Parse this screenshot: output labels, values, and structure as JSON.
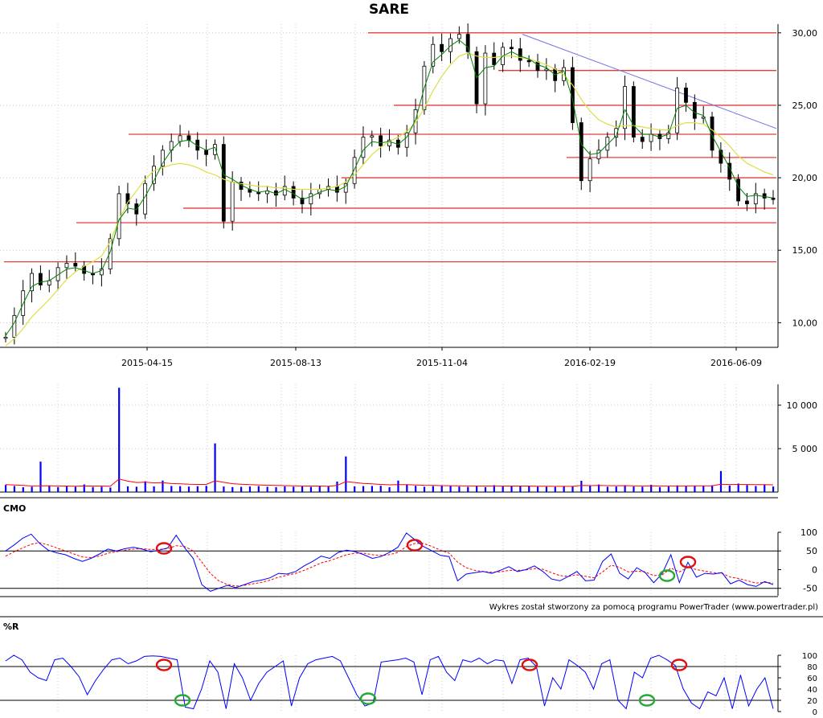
{
  "chart_data": [
    {
      "type": "candlestick",
      "title": "SARE",
      "y_ticks": [
        "30,00",
        "25,00",
        "20,00",
        "15,00",
        "10,00"
      ],
      "ylim": [
        8.3,
        30.6
      ],
      "x_ticks": [
        "2015-04-15",
        "2015-08-13",
        "2015-11-04",
        "2016-02-19",
        "2016-06-09"
      ],
      "price_close": [
        9.0,
        10.5,
        12.2,
        13.4,
        12.6,
        12.9,
        13.8,
        14.1,
        13.9,
        13.4,
        13.3,
        13.7,
        15.8,
        18.9,
        18.2,
        17.5,
        19.6,
        20.8,
        21.9,
        22.5,
        22.9,
        22.6,
        21.9,
        21.6,
        22.3,
        17.0,
        19.7,
        19.2,
        19.0,
        18.9,
        19.1,
        18.8,
        19.4,
        18.6,
        18.2,
        18.9,
        19.2,
        19.4,
        19.0,
        19.6,
        21.4,
        22.8,
        22.9,
        22.2,
        22.6,
        22.1,
        23.1,
        24.7,
        27.7,
        29.2,
        28.7,
        29.6,
        29.9,
        28.7,
        25.1,
        28.6,
        27.8,
        29.0,
        28.9,
        28.1,
        28.0,
        27.4,
        27.5,
        26.7,
        27.6,
        23.8,
        19.8,
        21.3,
        21.9,
        22.8,
        23.4,
        26.3,
        22.8,
        22.5,
        23.0,
        22.7,
        23.1,
        26.2,
        25.2,
        24.1,
        24.2,
        21.9,
        21.0,
        19.9,
        18.4,
        18.2,
        18.9,
        18.6,
        18.5
      ],
      "ma_short": [
        9.1,
        10.0,
        11.3,
        12.5,
        12.8,
        12.9,
        13.3,
        13.7,
        13.8,
        13.6,
        13.4,
        13.6,
        14.9,
        17.1,
        17.9,
        17.8,
        18.7,
        19.8,
        21.0,
        21.9,
        22.5,
        22.6,
        22.2,
        21.9,
        22.1,
        20.2,
        19.9,
        19.5,
        19.2,
        19.0,
        19.1,
        18.9,
        19.2,
        18.9,
        18.5,
        18.7,
        19.0,
        19.2,
        19.1,
        19.4,
        20.6,
        21.9,
        22.5,
        22.4,
        22.5,
        22.3,
        22.8,
        24.0,
        26.2,
        28.0,
        28.5,
        29.1,
        29.5,
        29.0,
        26.9,
        27.6,
        27.7,
        28.4,
        28.7,
        28.4,
        28.2,
        27.8,
        27.6,
        27.1,
        27.4,
        25.4,
        22.3,
        21.6,
        21.7,
        22.3,
        22.9,
        24.7,
        23.6,
        23.0,
        23.0,
        22.8,
        23.0,
        24.8,
        25.0,
        24.5,
        24.3,
        22.9,
        21.8,
        20.7,
        19.4,
        18.7,
        18.8,
        18.7,
        18.6
      ],
      "ma_long": [
        8.4,
        8.9,
        9.6,
        10.4,
        11.0,
        11.6,
        12.3,
        13.0,
        13.5,
        13.9,
        14.2,
        14.6,
        15.6,
        17.1,
        18.3,
        19.1,
        19.9,
        20.5,
        20.7,
        20.9,
        21.0,
        20.9,
        20.7,
        20.4,
        20.2,
        19.9,
        19.7,
        19.6,
        19.5,
        19.4,
        19.4,
        19.3,
        19.3,
        19.2,
        19.2,
        19.2,
        19.2,
        19.3,
        19.4,
        19.7,
        20.2,
        20.9,
        21.6,
        22.1,
        22.5,
        22.8,
        23.2,
        23.8,
        24.8,
        26.0,
        27.0,
        27.8,
        28.4,
        28.6,
        28.4,
        28.3,
        28.3,
        28.4,
        28.4,
        28.3,
        28.2,
        28.0,
        27.8,
        27.5,
        27.1,
        26.4,
        25.4,
        24.6,
        24.0,
        23.7,
        23.5,
        23.6,
        23.6,
        23.5,
        23.4,
        23.3,
        23.3,
        23.6,
        23.8,
        23.8,
        23.7,
        23.3,
        22.8,
        22.2,
        21.5,
        21.0,
        20.7,
        20.4,
        20.2
      ],
      "support_resistance_levels": [
        30.0,
        27.4,
        25.0,
        23.0,
        21.4,
        20.0,
        17.9,
        16.9,
        14.2
      ],
      "trendline": {
        "from": 29.9,
        "to": 23.4
      }
    },
    {
      "type": "bar",
      "series": [
        {
          "values": [
            820,
            700,
            560,
            620,
            3500,
            690,
            580,
            670,
            610,
            880,
            590,
            620,
            520,
            12000,
            660,
            610,
            1240,
            660,
            1320,
            700,
            680,
            630,
            680,
            720,
            5600,
            640,
            570,
            600,
            640,
            690,
            610,
            570,
            660,
            620,
            650,
            600,
            730,
            640,
            1210,
            4100,
            660,
            690,
            700,
            720,
            560,
            1320,
            830,
            720,
            610,
            680,
            700,
            690,
            630,
            600,
            710,
            570,
            790,
            640,
            700,
            680,
            690,
            620,
            610,
            590,
            700,
            640,
            1300,
            720,
            870,
            610,
            640,
            790,
            640,
            620,
            830,
            580,
            640,
            760,
            680,
            740,
            690,
            780,
            2420,
            760,
            980,
            810,
            700,
            880,
            640
          ]
        }
      ],
      "moving_average": [
        860,
        820,
        760,
        700,
        720,
        730,
        700,
        690,
        680,
        700,
        690,
        690,
        680,
        1500,
        1260,
        1100,
        1140,
        1060,
        1080,
        980,
        950,
        900,
        880,
        880,
        1300,
        1120,
        960,
        900,
        850,
        820,
        790,
        760,
        740,
        720,
        700,
        690,
        690,
        680,
        760,
        1200,
        1100,
        1000,
        940,
        880,
        830,
        860,
        850,
        820,
        780,
        760,
        740,
        730,
        720,
        700,
        700,
        690,
        700,
        690,
        690,
        690,
        690,
        680,
        670,
        660,
        660,
        660,
        760,
        740,
        770,
        740,
        730,
        740,
        720,
        700,
        720,
        700,
        700,
        700,
        700,
        710,
        710,
        720,
        900,
        870,
        880,
        870,
        850,
        860,
        830
      ],
      "y_ticks": [
        "10 000",
        "5 000"
      ],
      "ylim": [
        0,
        12400
      ]
    },
    {
      "type": "line",
      "title": "CMO",
      "series": [
        {
          "values": [
            50,
            66,
            84,
            95,
            70,
            52,
            45,
            40,
            30,
            22,
            30,
            42,
            55,
            50,
            56,
            60,
            55,
            48,
            52,
            58,
            92,
            58,
            30,
            -40,
            -58,
            -50,
            -42,
            -48,
            -40,
            -32,
            -28,
            -22,
            -10,
            -12,
            -5,
            10,
            22,
            36,
            30,
            46,
            52,
            48,
            40,
            30,
            35,
            46,
            60,
            98,
            80,
            62,
            50,
            38,
            35,
            -30,
            -12,
            -8,
            -5,
            -10,
            -2,
            8,
            -5,
            0,
            10,
            -5,
            -25,
            -30,
            -18,
            -5,
            -30,
            -28,
            22,
            42,
            -10,
            -25,
            5,
            -8,
            -35,
            -10,
            40,
            -35,
            20,
            -20,
            -10,
            -12,
            -8,
            -38,
            -28,
            -40,
            -45,
            -32,
            -40
          ]
        }
      ],
      "signal": [
        36,
        48,
        58,
        68,
        72,
        66,
        58,
        50,
        42,
        34,
        32,
        36,
        44,
        48,
        52,
        55,
        56,
        54,
        54,
        56,
        64,
        62,
        50,
        20,
        -10,
        -30,
        -40,
        -44,
        -42,
        -38,
        -34,
        -28,
        -20,
        -15,
        -10,
        -2,
        8,
        18,
        24,
        32,
        40,
        44,
        44,
        40,
        38,
        40,
        46,
        62,
        70,
        70,
        62,
        52,
        44,
        20,
        5,
        -2,
        -5,
        -7,
        -6,
        -2,
        -2,
        -1,
        3,
        1,
        -8,
        -16,
        -18,
        -14,
        -18,
        -22,
        -6,
        12,
        6,
        -6,
        -4,
        -6,
        -16,
        -14,
        4,
        -6,
        6,
        0,
        -4,
        -8,
        -10,
        -20,
        -24,
        -30,
        -36,
        -34,
        -36
      ],
      "y_ticks": [
        "100",
        "50",
        "0",
        "-50"
      ],
      "ylim": [
        -70,
        100
      ],
      "reference_lines": [
        50,
        -50
      ]
    },
    {
      "type": "line",
      "title": "%R",
      "series": [
        {
          "values": [
            90,
            100,
            92,
            70,
            60,
            55,
            92,
            95,
            80,
            62,
            30,
            55,
            75,
            92,
            95,
            85,
            90,
            98,
            99,
            98,
            95,
            92,
            8,
            5,
            40,
            90,
            70,
            5,
            85,
            60,
            20,
            50,
            70,
            80,
            90,
            10,
            60,
            85,
            92,
            95,
            98,
            90,
            60,
            30,
            10,
            15,
            88,
            90,
            92,
            95,
            88,
            30,
            92,
            98,
            70,
            55,
            92,
            88,
            95,
            85,
            92,
            90,
            50,
            92,
            95,
            80,
            10,
            60,
            40,
            92,
            82,
            70,
            40,
            85,
            92,
            20,
            5,
            70,
            60,
            95,
            100,
            92,
            82,
            40,
            15,
            5,
            35,
            28,
            60,
            5,
            65,
            10,
            40,
            60,
            5
          ]
        }
      ],
      "y_ticks": [
        "100",
        "80",
        "60",
        "40",
        "20",
        "0"
      ],
      "ylim": [
        0,
        100
      ],
      "reference_lines": [
        80,
        20
      ]
    }
  ],
  "panel_labels": {
    "cmo": "CMO",
    "wr": "%R"
  },
  "credit": "Wykres został stworzony za pomocą programu PowerTrader (www.powertrader.pl)",
  "colors": {
    "price": "#000000",
    "ma_short": "#008000",
    "ma_long": "#dddd44",
    "levels": "#e83c3c",
    "trendline": "#6f6fe6",
    "volume": "#0000ff",
    "volume_ma": "#ff0000",
    "indicator": "#0000ff",
    "signal": "#ff0000",
    "grid": "#c8c8c8"
  }
}
